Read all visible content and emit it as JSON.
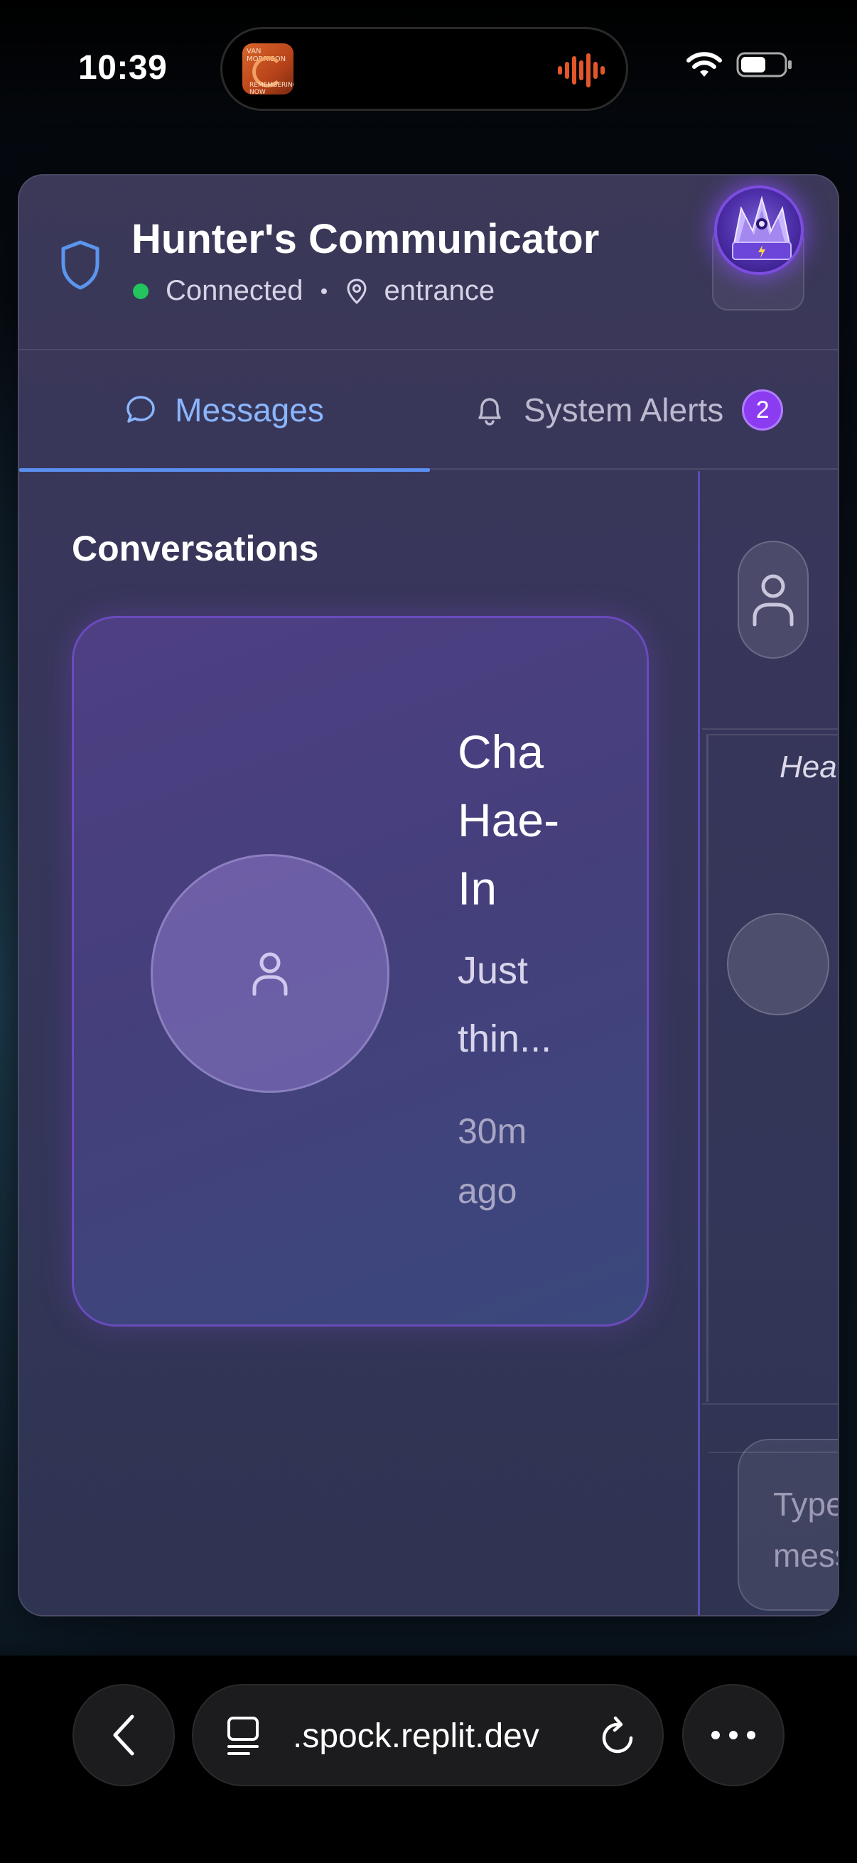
{
  "status_bar": {
    "time": "10:39",
    "now_playing_art_text": "VAN MORRISON",
    "now_playing_art_subtext": "REMEMBERING NOW"
  },
  "app": {
    "title": "Hunter's Communicator",
    "connection_status": "Connected",
    "location": "entrance",
    "status_color": "#22c55e",
    "accent_color": "#5b8ff0"
  },
  "tabs": [
    {
      "label": "Messages",
      "icon": "chat-bubble-icon",
      "active": true
    },
    {
      "label": "System Alerts",
      "icon": "bell-icon",
      "badge": "2",
      "active": false
    }
  ],
  "conversations": {
    "heading": "Conversations",
    "items": [
      {
        "name": "Cha Hae-In",
        "preview": "Just thin...",
        "time": "30m ago"
      }
    ]
  },
  "chat": {
    "italic_text": "Hea",
    "input_placeholder": "Type a message..."
  },
  "browser": {
    "url": ".spock.replit.dev"
  }
}
